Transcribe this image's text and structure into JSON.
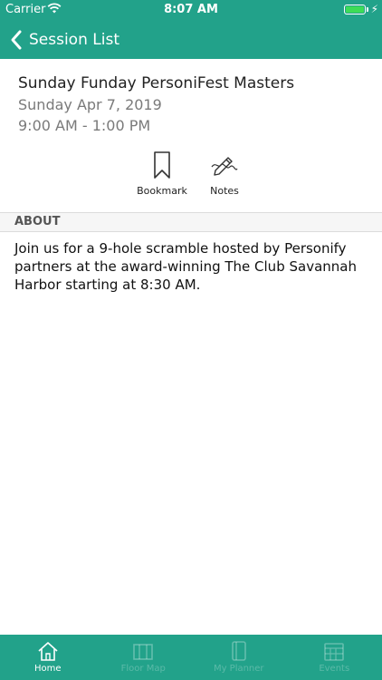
{
  "status_bar": {
    "carrier": "Carrier",
    "time": "8:07 AM"
  },
  "nav": {
    "back_label": "Session List"
  },
  "session": {
    "title": "Sunday Funday PersoniFest Masters",
    "date": "Sunday Apr 7, 2019",
    "time_range": "9:00 AM - 1:00 PM"
  },
  "actions": {
    "bookmark_label": "Bookmark",
    "notes_label": "Notes"
  },
  "about": {
    "header": "ABOUT",
    "text": "Join us for a 9-hole scramble hosted by Personify partners at the award-winning The Club Savannah Harbor starting at 8:30 AM."
  },
  "tabs": [
    {
      "label": "Home",
      "icon": "home-icon",
      "active": true
    },
    {
      "label": "Floor Map",
      "icon": "map-icon",
      "active": false
    },
    {
      "label": "My Planner",
      "icon": "planner-icon",
      "active": false
    },
    {
      "label": "Events",
      "icon": "calendar-icon",
      "active": false
    }
  ],
  "colors": {
    "primary": "#22a28a",
    "battery": "#3ddc57"
  }
}
